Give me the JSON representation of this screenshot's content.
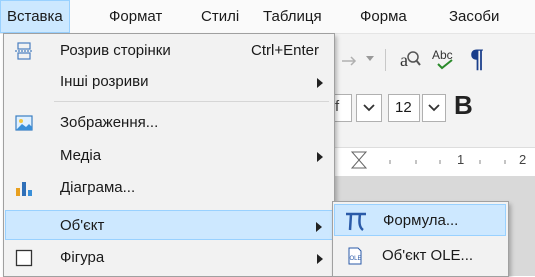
{
  "menubar": {
    "items": [
      {
        "label": "Вставка"
      },
      {
        "label": "Формат"
      },
      {
        "label": "Стилі"
      },
      {
        "label": "Таблиця"
      },
      {
        "label": "Форма"
      },
      {
        "label": "Засоби"
      }
    ]
  },
  "toolbar": {
    "font_size": "12",
    "bold_glyph": "B",
    "ruler_marks": [
      "1",
      "2"
    ],
    "pilcrow": "¶"
  },
  "insert_menu": {
    "items": [
      {
        "label": "Розрив сторінки",
        "accelerator": "Ctrl+Enter",
        "icon": "page-break-icon"
      },
      {
        "label": "Інші розриви",
        "submenu": true
      },
      {
        "label": "Зображення...",
        "icon": "image-icon"
      },
      {
        "label": "Медіа",
        "submenu": true
      },
      {
        "label": "Діаграма...",
        "icon": "chart-icon"
      },
      {
        "label": "Об'єкт",
        "submenu": true,
        "selected": true
      },
      {
        "label": "Фігура",
        "submenu": true,
        "icon": "shape-icon"
      }
    ]
  },
  "object_submenu": {
    "items": [
      {
        "label": "Формула...",
        "icon": "pi-formula-icon",
        "selected": true
      },
      {
        "label": "Об'єкт OLE...",
        "icon": "ole-object-icon"
      }
    ]
  },
  "colors": {
    "highlight": "#cde8ff",
    "highlight_border": "#99d1ff",
    "menu_bg": "#f2f2f2"
  }
}
